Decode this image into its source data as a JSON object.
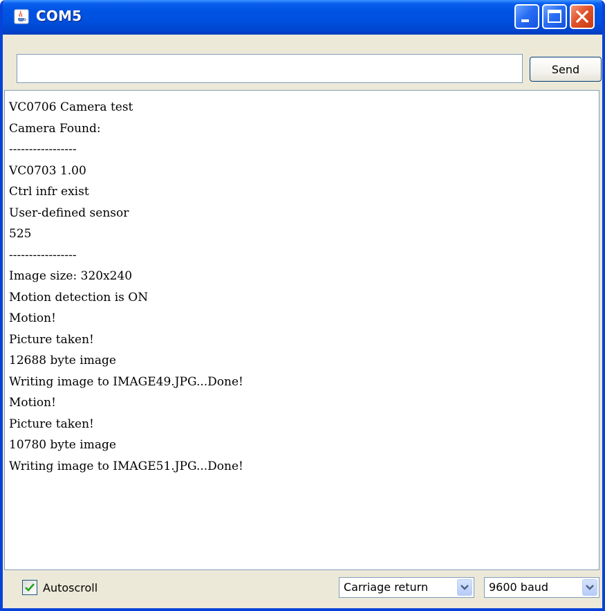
{
  "window": {
    "title": "COM5",
    "icon": "java-cup-icon",
    "controls": [
      "minimize-icon",
      "maximize-icon",
      "close-icon"
    ]
  },
  "send_row": {
    "input_value": "",
    "send_label": "Send"
  },
  "output": {
    "lines": [
      "VC0706 Camera test",
      "Camera Found:",
      "-----------------",
      "VC0703 1.00",
      "Ctrl infr exist",
      "User-defined sensor",
      "525",
      "-----------------",
      "Image size: 320x240",
      "Motion detection is ON",
      "Motion!",
      "Picture taken!",
      "12688 byte image",
      "Writing image to IMAGE49.JPG...Done!",
      "Motion!",
      "Picture taken!",
      "10780 byte image",
      "Writing image to IMAGE51.JPG...Done!"
    ]
  },
  "bottom": {
    "autoscroll_label": "Autoscroll",
    "autoscroll_checked": true,
    "line_ending": "Carriage return",
    "baud": "9600 baud"
  },
  "colors": {
    "titlebar": "#0054e3",
    "close_button": "#e0532b",
    "window_face": "#ece9d8",
    "field_border": "#7f9db9"
  }
}
